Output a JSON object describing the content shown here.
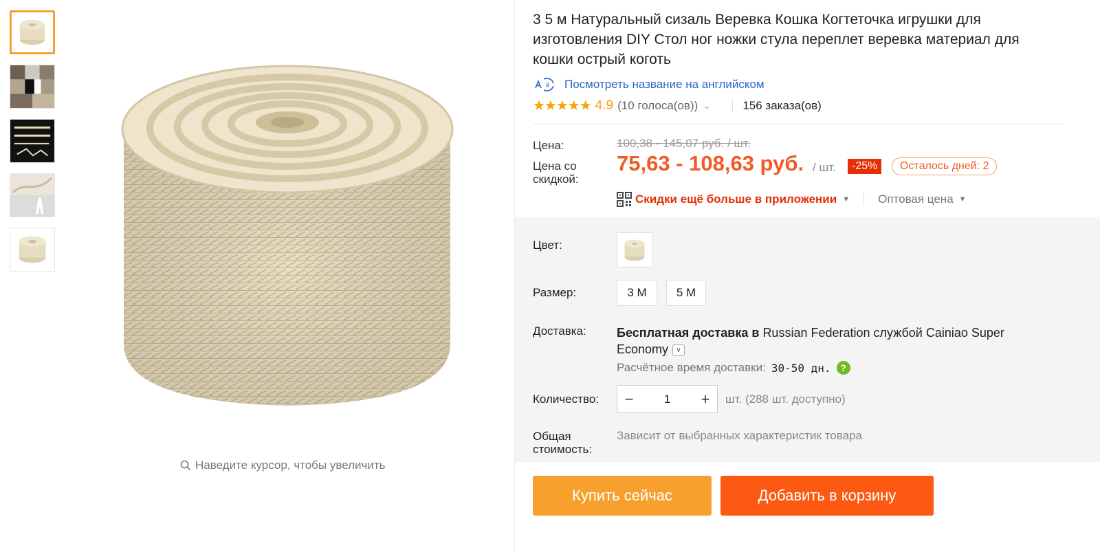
{
  "product": {
    "title": "3 5 м Натуральный сизаль Веревка Кошка Когтеточка игрушки для изготовления DIY Стол ног ножки стула переплет веревка материал для кошки острый коготь",
    "translate_link": "Посмотреть название на английском",
    "rating_stars": "★★★★★",
    "rating": "4.9",
    "votes": "(10 голоса(ов))",
    "orders": "156 заказа(ов)"
  },
  "gallery": {
    "zoom_hint": "Наведите курсор, чтобы увеличить",
    "thumbnails": [
      "rope-coil",
      "photo-collage",
      "rope-strands",
      "rope-closeup",
      "rope-coil"
    ],
    "active_index": 0
  },
  "price": {
    "price_label": "Цена:",
    "old_price": "100,38 - 145,07 руб. / шт.",
    "discount_label": "Цена со скидкой:",
    "new_price": "75,63 - 108,63 руб.",
    "per_unit": "/ шт.",
    "discount_badge": "-25%",
    "days_left": "Осталось дней: 2",
    "app_discount": "Скидки ещё больше в приложении",
    "wholesale": "Оптовая цена"
  },
  "options": {
    "color_label": "Цвет:",
    "size_label": "Размер:",
    "sizes": [
      "3 M",
      "5 M"
    ],
    "shipping_label": "Доставка:",
    "shipping_free": "Бесплатная доставка в",
    "shipping_rest": "Russian Federation службой Cainiao Super Economy",
    "eta_label": "Расчётное время доставки:",
    "eta_value": "30-50 дн.",
    "quantity_label": "Количество:",
    "quantity_value": "1",
    "quantity_available": "шт. (288 шт. доступно)",
    "total_label": "Общая стоимость:",
    "total_value": "Зависит от выбранных характеристик товара"
  },
  "actions": {
    "buy_now": "Купить сейчас",
    "add_to_cart": "Добавить в корзину"
  },
  "colors": {
    "accent_orange": "#f05a24",
    "buy_button": "#f7a02e",
    "cart_button": "#fc5a12",
    "discount_red": "#e62e04",
    "star": "#f7a400",
    "link": "#2a66c6"
  }
}
